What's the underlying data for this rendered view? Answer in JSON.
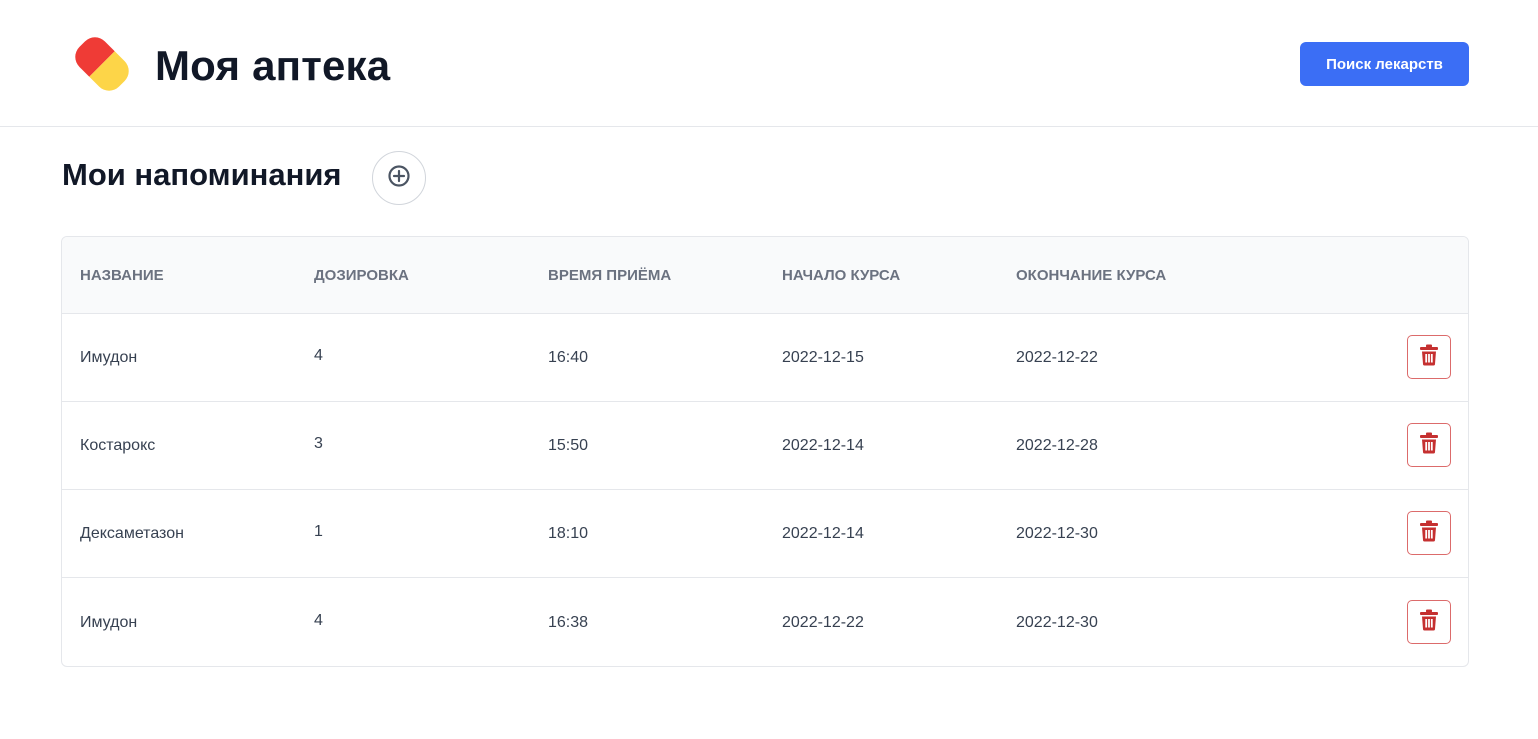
{
  "header": {
    "logo_icon": "pill-icon",
    "title": "Моя аптека",
    "search_button_label": "Поиск лекарств",
    "accent_color": "#3b6ef5"
  },
  "reminders": {
    "title": "Мои напоминания",
    "add_icon": "plus-circle-icon",
    "columns": [
      "Название",
      "Дозировка",
      "Время приёма",
      "Начало курса",
      "Окончание курса"
    ],
    "rows": [
      {
        "name": "Имудон",
        "dosage": "4",
        "time": "16:40",
        "start": "2022-12-15",
        "end": "2022-12-22"
      },
      {
        "name": "Костарокс",
        "dosage": "3",
        "time": "15:50",
        "start": "2022-12-14",
        "end": "2022-12-28"
      },
      {
        "name": "Дексаметазон",
        "dosage": "1",
        "time": "18:10",
        "start": "2022-12-14",
        "end": "2022-12-30"
      },
      {
        "name": "Имудон",
        "dosage": "4",
        "time": "16:38",
        "start": "2022-12-22",
        "end": "2022-12-30"
      }
    ],
    "delete_icon": "trash-icon",
    "delete_color": "#c53030"
  }
}
